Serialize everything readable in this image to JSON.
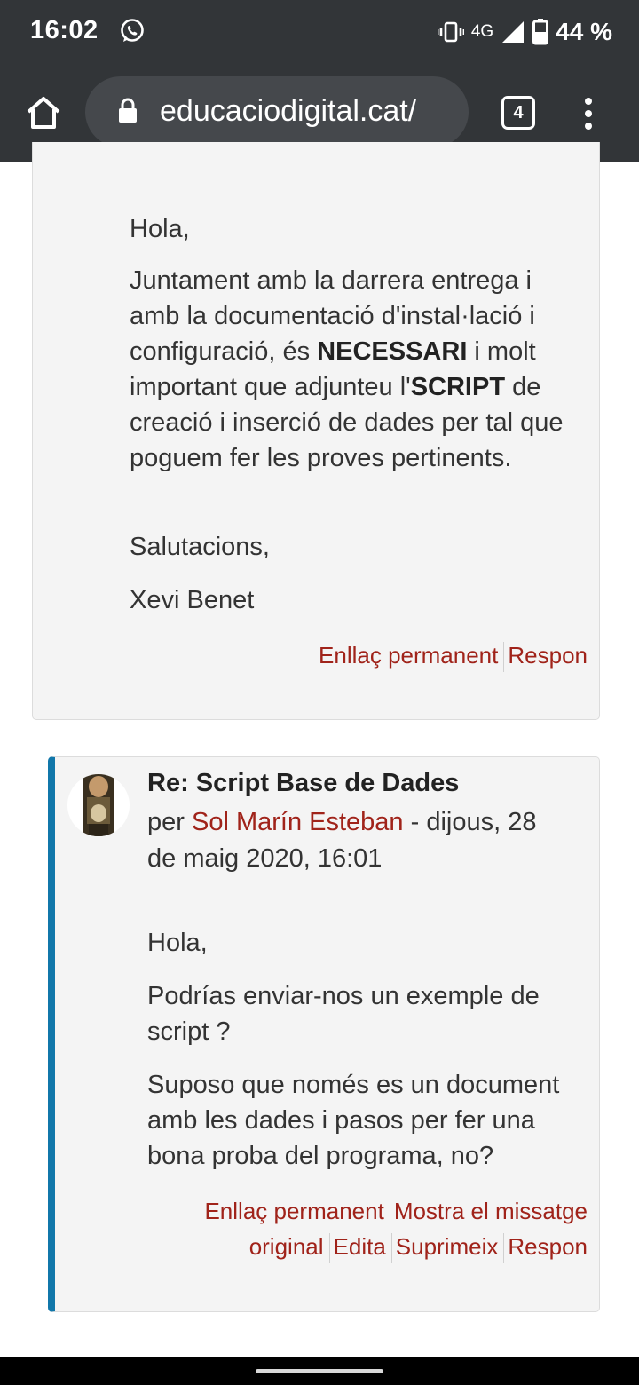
{
  "status_bar": {
    "time": "16:02",
    "network": "4G",
    "battery": "44 %"
  },
  "browser": {
    "url": "educaciodigital.cat/",
    "tab_count": "4"
  },
  "post1": {
    "greeting": "Hola,",
    "body_part1": "Juntament amb la darrera entrega i amb la documentació d'instal·lació i configuració, és ",
    "bold1": "NECESSARI",
    "body_part2": " i molt important que adjunteu l'",
    "bold2": "SCRIPT",
    "body_part3": " de creació i inserció de dades per tal que poguem fer les proves pertinents.",
    "closing": "Salutacions,",
    "signature": "Xevi Benet",
    "actions": {
      "permalink": "Enllaç permanent",
      "reply": "Respon"
    }
  },
  "post2": {
    "subject": "Re: Script Base de Dades",
    "by_prefix": "per ",
    "author": "Sol Marín Esteban",
    "date_line1": " - dijous, 28",
    "date_line2": "de maig 2020, 16:01",
    "greeting": "Hola,",
    "para1_line1": "Podrías enviar-nos un exemple de",
    "para1_line2": "script ?",
    "para2_line1": "Suposo que només es un document",
    "para2_line2": "amb les dades i pasos per fer una",
    "para2_line3": "bona proba del programa, no?",
    "actions": {
      "permalink": "Enllaç permanent",
      "show_original_1": "Mostra el missatge",
      "show_original_2": "original",
      "edit": "Edita",
      "delete": "Suprimeix",
      "reply": "Respon"
    }
  },
  "colors": {
    "chrome_bg": "#323538",
    "link": "#a0231a",
    "post_bg": "#f4f4f4",
    "reply_border": "#1177aa"
  }
}
